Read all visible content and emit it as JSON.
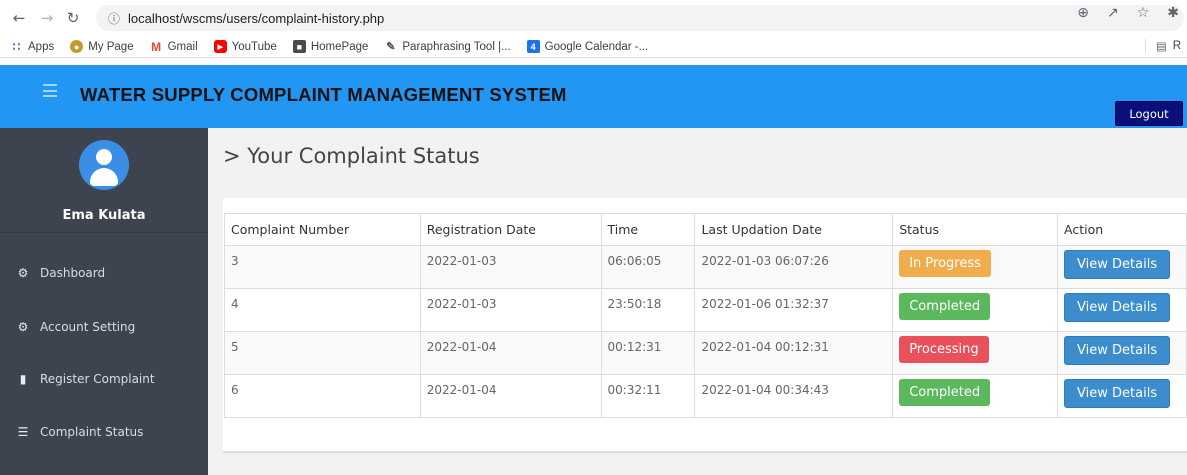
{
  "browser": {
    "url": "localhost/wscms/users/complaint-history.php",
    "bookmarks": [
      {
        "label": "Apps"
      },
      {
        "label": "My Page"
      },
      {
        "label": "Gmail"
      },
      {
        "label": "YouTube"
      },
      {
        "label": "HomePage"
      },
      {
        "label": "Paraphrasing Tool |..."
      },
      {
        "label": "Google Calendar -..."
      }
    ],
    "right_label": "R"
  },
  "header": {
    "title": "WATER SUPPLY COMPLAINT MANAGEMENT SYSTEM",
    "logout_label": "Logout"
  },
  "sidebar": {
    "username": "Ema Kulata",
    "items": [
      {
        "label": "Dashboard",
        "icon": "dashboard-icon"
      },
      {
        "label": "Account Setting",
        "icon": "cogs-icon"
      },
      {
        "label": "Register Complaint",
        "icon": "book-icon"
      },
      {
        "label": "Complaint Status",
        "icon": "list-icon"
      }
    ]
  },
  "main": {
    "title": "> Your Complaint Status",
    "table": {
      "headers": [
        "Complaint Number",
        "Registration Date",
        "Time",
        "Last Updation Date",
        "Status",
        "Action"
      ],
      "rows": [
        {
          "number": "3",
          "reg_date": "2022-01-03",
          "time": "06:06:05",
          "last_update": "2022-01-03 06:07:26",
          "status": "In Progress",
          "status_color": "#f0ad4e",
          "action": "View Details"
        },
        {
          "number": "4",
          "reg_date": "2022-01-03",
          "time": "23:50:18",
          "last_update": "2022-01-06 01:32:37",
          "status": "Completed",
          "status_color": "#5cb85c",
          "action": "View Details"
        },
        {
          "number": "5",
          "reg_date": "2022-01-04",
          "time": "00:12:31",
          "last_update": "2022-01-04 00:12:31",
          "status": "Processing",
          "status_color": "#e8505b",
          "action": "View Details"
        },
        {
          "number": "6",
          "reg_date": "2022-01-04",
          "time": "00:32:11",
          "last_update": "2022-01-04 00:34:43",
          "status": "Completed",
          "status_color": "#5cb85c",
          "action": "View Details"
        }
      ]
    }
  },
  "colors": {
    "header_bg": "#2196f3",
    "sidebar_bg": "#3d434f",
    "logout_bg": "#0b0f7a",
    "view_button_bg": "#3c8dcd"
  }
}
